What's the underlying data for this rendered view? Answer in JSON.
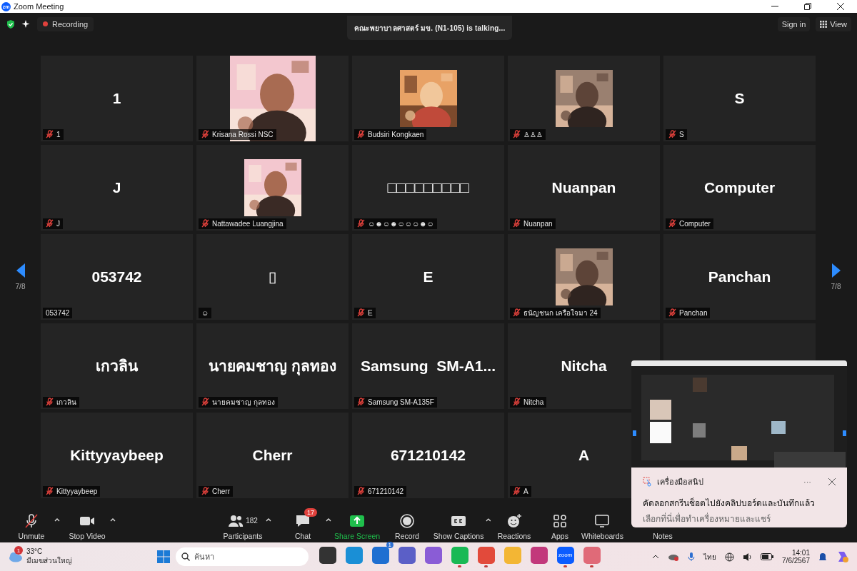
{
  "window": {
    "logo": "zm",
    "title": "Zoom Meeting"
  },
  "top_bar": {
    "recording": "Recording",
    "speaker": "คณะพยาบาลศาสตร์ มข. (N1-105) is talking...",
    "sign_in": "Sign in",
    "view": "View"
  },
  "pager": {
    "left": "7/8",
    "right": "7/8"
  },
  "tiles": [
    {
      "kind": "name",
      "name": "1",
      "label": "1",
      "muted": true
    },
    {
      "kind": "video",
      "label": "Krisana Rossi NSC",
      "muted": true
    },
    {
      "label": "Budsiri Kongkaen",
      "muted": true
    },
    {
      "label": "♙♙♙",
      "muted": true
    },
    {
      "kind": "name",
      "name": "S",
      "label": "S",
      "muted": true
    },
    {
      "kind": "name",
      "name": "J",
      "label": "J",
      "muted": true
    },
    {
      "label": "Nattawadee Luangjina",
      "muted": true
    },
    {
      "kind": "name",
      "name": "□□□□□□□□□",
      "label": "☺☻☺☻☺☺☺☻☺",
      "muted": true
    },
    {
      "kind": "name",
      "name": "Nuanpan",
      "label": "Nuanpan",
      "muted": true
    },
    {
      "kind": "name",
      "name": "Computer",
      "label": "Computer",
      "muted": true
    },
    {
      "kind": "name",
      "name": "053742",
      "label": "053742",
      "muted": false
    },
    {
      "kind": "name",
      "name": "▯",
      "label": "☺",
      "muted": false
    },
    {
      "kind": "name",
      "name": "E",
      "label": "E",
      "muted": true
    },
    {
      "label": "ธนัญชนก เครือใจมา 24",
      "muted": true
    },
    {
      "kind": "name",
      "name": "Panchan",
      "label": "Panchan",
      "muted": true
    },
    {
      "kind": "name",
      "name": "เกวลิน",
      "label": "เกวลิน",
      "muted": true
    },
    {
      "kind": "name",
      "name": "นายคมชาญ กุลทอง",
      "label": "นายคมชาญ กุลทอง",
      "muted": true
    },
    {
      "kind": "name",
      "name": "Samsung  SM-A1...",
      "label": "Samsung SM-A135F",
      "muted": true
    },
    {
      "kind": "name",
      "name": "Nitcha",
      "label": "Nitcha",
      "muted": true
    },
    {
      "kind": "empty"
    },
    {
      "kind": "name",
      "name": "Kittyyaybeep",
      "label": "Kittyyaybeep",
      "muted": true
    },
    {
      "kind": "name",
      "name": "Cherr",
      "label": "Cherr",
      "muted": true
    },
    {
      "kind": "name",
      "name": "671210142",
      "label": "671210142",
      "muted": true
    },
    {
      "kind": "name",
      "name": "A",
      "label": "A",
      "muted": true
    }
  ],
  "toolbar": [
    {
      "kind": "mic",
      "label": "Unmute",
      "caret": true
    },
    {
      "kind": "video",
      "label": "Stop Video",
      "caret": true
    },
    {
      "kind": "participants",
      "label": "Participants",
      "count": "182",
      "caret": true
    },
    {
      "kind": "chat",
      "label": "Chat",
      "badge": "17",
      "caret": true
    },
    {
      "kind": "share",
      "label": "Share Screen",
      "caret": false
    },
    {
      "kind": "record",
      "label": "Record",
      "caret": false
    },
    {
      "kind": "captions",
      "label": "Show Captions",
      "caret": true
    },
    {
      "kind": "reactions",
      "label": "Reactions",
      "caret": false
    },
    {
      "kind": "apps",
      "label": "Apps",
      "caret": false
    },
    {
      "kind": "whiteboards",
      "label": "Whiteboards",
      "caret": false
    },
    {
      "kind": "notes",
      "label": "Notes",
      "caret": false
    }
  ],
  "toast": {
    "app": "เครื่องมือสนิป",
    "more": "···",
    "title": "คัดลอกสกรีนช็อตไปยังคลิปบอร์ดและบันทึกแล้ว",
    "body": "เลือกที่นี่เพื่อทำเครื่องหมายและแชร์"
  },
  "taskbar": {
    "weather": {
      "badge": "1",
      "temp": "33°C",
      "desc": "มีเมฆส่วนใหญ่"
    },
    "search_placeholder": "ค้นหา",
    "apps": [
      {
        "kind": "taskview",
        "running": false
      },
      {
        "kind": "browser",
        "running": false
      },
      {
        "kind": "store",
        "running": false,
        "badge": "1"
      },
      {
        "kind": "teams",
        "running": false
      },
      {
        "kind": "copilot",
        "running": false
      },
      {
        "kind": "chat",
        "running": true
      },
      {
        "kind": "chrome",
        "running": true
      },
      {
        "kind": "folder",
        "running": false
      },
      {
        "kind": "books",
        "running": false
      },
      {
        "kind": "zoom",
        "running": true,
        "text": "zoom"
      },
      {
        "kind": "snip",
        "running": true
      }
    ],
    "language": "ไทย",
    "time": "14:01",
    "date": "7/6/2567"
  }
}
